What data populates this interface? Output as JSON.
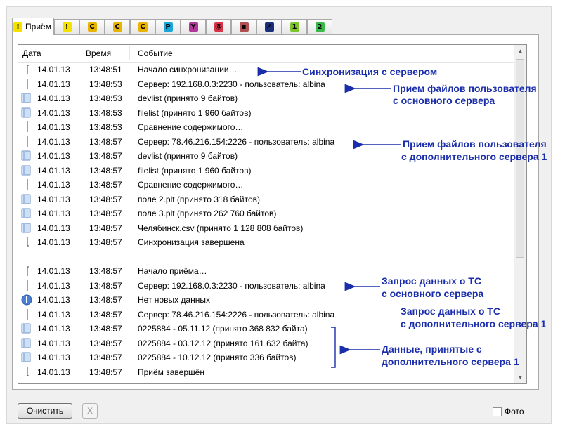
{
  "tabs": [
    {
      "label": "Приём",
      "icon": "exclamation-icon",
      "glyph": "!",
      "color": "#f5e100"
    },
    {
      "label": "",
      "icon": "exclamation-icon",
      "glyph": "!",
      "color": "#f5e100"
    },
    {
      "label": "",
      "icon": "c-icon",
      "glyph": "C",
      "color": "#e8b400"
    },
    {
      "label": "",
      "icon": "c-icon",
      "glyph": "C",
      "color": "#e8b400"
    },
    {
      "label": "",
      "icon": "c-icon",
      "glyph": "C",
      "color": "#e8b400"
    },
    {
      "label": "",
      "icon": "p-icon",
      "glyph": "P",
      "color": "#1aa6d9"
    },
    {
      "label": "",
      "icon": "filter-icon",
      "glyph": "Y",
      "color": "#b3369a"
    },
    {
      "label": "",
      "icon": "mail-icon",
      "glyph": "@",
      "color": "#d9334a"
    },
    {
      "label": "",
      "icon": "device-icon",
      "glyph": "▪",
      "color": "#b05050"
    },
    {
      "label": "",
      "icon": "chart-icon",
      "glyph": "↗",
      "color": "#1b2f7a"
    },
    {
      "label": "",
      "icon": "one-icon",
      "glyph": "1",
      "color": "#7cc62b"
    },
    {
      "label": "",
      "icon": "two-icon",
      "glyph": "2",
      "color": "#3bb84a"
    }
  ],
  "columns": {
    "date": "Дата",
    "time": "Время",
    "event": "Событие"
  },
  "rows": [
    {
      "icon": "bracket-start",
      "date": "14.01.13",
      "time": "13:48:51",
      "event": "Начало синхронизации…"
    },
    {
      "icon": "bracket-mid",
      "date": "14.01.13",
      "time": "13:48:53",
      "event": "Сервер: 192.168.0.3:2230 - пользователь: albina"
    },
    {
      "icon": "file",
      "date": "14.01.13",
      "time": "13:48:53",
      "event": "devlist (принято 9 байтов)"
    },
    {
      "icon": "file",
      "date": "14.01.13",
      "time": "13:48:53",
      "event": "filelist (принято 1 960 байтов)"
    },
    {
      "icon": "bracket-mid",
      "date": "14.01.13",
      "time": "13:48:53",
      "event": "Сравнение содержимого…"
    },
    {
      "icon": "bracket-mid",
      "date": "14.01.13",
      "time": "13:48:57",
      "event": "Сервер: 78.46.216.154:2226 - пользователь: albina"
    },
    {
      "icon": "file",
      "date": "14.01.13",
      "time": "13:48:57",
      "event": "devlist (принято 9 байтов)"
    },
    {
      "icon": "file",
      "date": "14.01.13",
      "time": "13:48:57",
      "event": "filelist (принято 1 960 байтов)"
    },
    {
      "icon": "bracket-mid",
      "date": "14.01.13",
      "time": "13:48:57",
      "event": "Сравнение содержимого…"
    },
    {
      "icon": "file",
      "date": "14.01.13",
      "time": "13:48:57",
      "event": "поле 2.plt (принято 318 байтов)"
    },
    {
      "icon": "file",
      "date": "14.01.13",
      "time": "13:48:57",
      "event": "поле 3.plt (принято 262 760 байтов)"
    },
    {
      "icon": "file",
      "date": "14.01.13",
      "time": "13:48:57",
      "event": "Челябинск.csv (принято 1 128 808 байтов)"
    },
    {
      "icon": "bracket-end",
      "date": "14.01.13",
      "time": "13:48:57",
      "event": "Синхронизация завершена"
    },
    {
      "icon": "none",
      "date": "",
      "time": "",
      "event": ""
    },
    {
      "icon": "bracket-start",
      "date": "14.01.13",
      "time": "13:48:57",
      "event": "Начало приёма…"
    },
    {
      "icon": "bracket-mid",
      "date": "14.01.13",
      "time": "13:48:57",
      "event": "Сервер: 192.168.0.3:2230 - пользователь: albina"
    },
    {
      "icon": "info",
      "date": "14.01.13",
      "time": "13:48:57",
      "event": "Нет новых данных"
    },
    {
      "icon": "bracket-mid",
      "date": "14.01.13",
      "time": "13:48:57",
      "event": "Сервер: 78.46.216.154:2226 - пользователь: albina"
    },
    {
      "icon": "file",
      "date": "14.01.13",
      "time": "13:48:57",
      "event": "0225884 - 05.11.12 (принято 368 832 байта)"
    },
    {
      "icon": "file",
      "date": "14.01.13",
      "time": "13:48:57",
      "event": "0225884 - 03.12.12 (принято 161 632 байта)"
    },
    {
      "icon": "file",
      "date": "14.01.13",
      "time": "13:48:57",
      "event": "0225884 - 10.12.12 (принято 336 байтов)"
    },
    {
      "icon": "bracket-end",
      "date": "14.01.13",
      "time": "13:48:57",
      "event": "Приём завершён"
    }
  ],
  "annotations": {
    "sync": "Синхронизация с сервером",
    "main_files_1": "Прием файлов пользователя",
    "main_files_2": "с основного сервера",
    "extra_files_1": "Прием файлов пользователя",
    "extra_files_2": "с дополнительного сервера 1",
    "ts_main_1": "Запрос данных о ТС",
    "ts_main_2": "с основного сервера",
    "ts_extra_1": "Запрос данных о ТС",
    "ts_extra_2": "с дополнительного сервера 1",
    "data_1": "Данные, принятые с",
    "data_2": "дополнительного сервера 1"
  },
  "bottom": {
    "clear_label": "Очистить",
    "x_label": "X",
    "photo_label": "Фото"
  },
  "colors": {
    "annotation": "#1a2daa",
    "file_icon": "#8fb4e3"
  }
}
